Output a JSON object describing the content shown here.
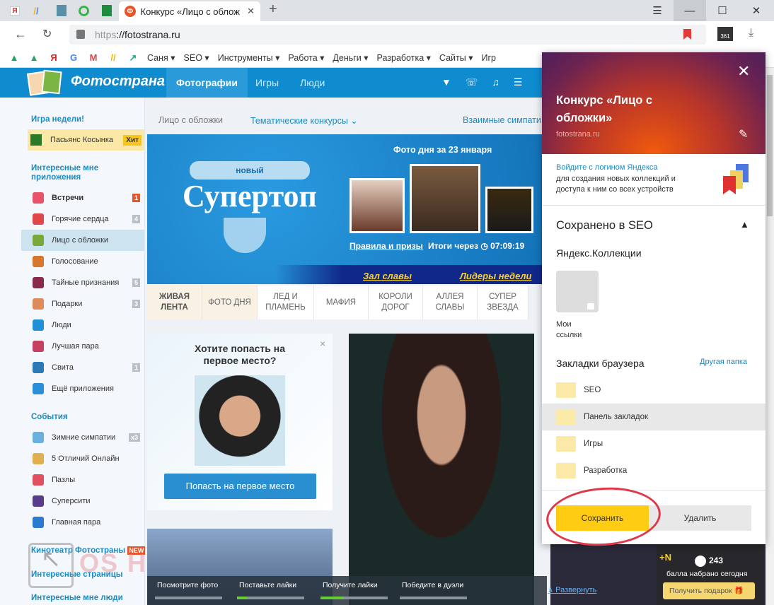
{
  "browser": {
    "pinned_tabs": [
      {
        "icon": "yandex-icon",
        "label": "Я"
      },
      {
        "icon": "google-ads-icon"
      },
      {
        "icon": "avatar-icon"
      },
      {
        "icon": "circle-icon"
      },
      {
        "icon": "sheets-icon"
      }
    ],
    "active_tab": {
      "title": "Конкурс «Лицо с облож",
      "favicon": "Ф"
    },
    "new_tab": "+",
    "url_scheme": "https",
    "url_rest": "://fotostrana.ru",
    "ext_badge": "361",
    "bookmarks": [
      "Саня",
      "SEO",
      "Инструменты",
      "Работа",
      "Деньги",
      "Разработка",
      "Сайты",
      "Игр"
    ]
  },
  "site": {
    "logo_text": "Фотострана",
    "nav": [
      "Фотографии",
      "Игры",
      "Люди"
    ],
    "sidebar": {
      "game_week_title": "Игра недели!",
      "game_week": {
        "label": "Пасьянс Косынка",
        "badge": "Хит"
      },
      "apps_title": "Интересные мне приложения",
      "apps": [
        {
          "label": "Встречи",
          "badge": "1",
          "color": "#e7536a"
        },
        {
          "label": "Горячие сердца",
          "badge": "4",
          "color": "#e04848"
        },
        {
          "label": "Лицо с обложки",
          "badge": "",
          "color": "#7aa83a"
        },
        {
          "label": "Голосование",
          "badge": "",
          "color": "#d7772d"
        },
        {
          "label": "Тайные признания",
          "badge": "5",
          "color": "#8a2a4a"
        },
        {
          "label": "Подарки",
          "badge": "3",
          "color": "#e08a5a"
        },
        {
          "label": "Люди",
          "badge": "",
          "color": "#1f8fd8"
        },
        {
          "label": "Лучшая пара",
          "badge": "",
          "color": "#c84060"
        },
        {
          "label": "Свита",
          "badge": "1",
          "color": "#2a7ab8"
        },
        {
          "label": "Ещё приложения",
          "badge": "",
          "color": "#2a8fd8"
        }
      ],
      "events_title": "События",
      "events": [
        {
          "label": "Зимние симпатии",
          "badge": "x3",
          "color": "#6ab0e0"
        },
        {
          "label": "5 Отличий Онлайн",
          "badge": "",
          "color": "#e0b050"
        },
        {
          "label": "Пазлы",
          "badge": "",
          "color": "#e05060"
        },
        {
          "label": "Суперсити",
          "badge": "",
          "color": "#5a3a8a"
        },
        {
          "label": "Главная пара",
          "badge": "",
          "color": "#2a7ad0"
        }
      ],
      "cinema": "Кинотеатр Фотостраны",
      "cinema_badge": "NEW",
      "pages": "Интересные страницы",
      "people": "Интересные мне люди"
    },
    "subnav": {
      "current": "Лицо с обложки",
      "contests": "Тематические конкурсы",
      "mutual": "Взаимные симпати"
    },
    "banner": {
      "small": "новый",
      "title": "Супертоп",
      "photo_day": "Фото дня за 23 января",
      "rules": "Правила и призы",
      "results": "Итоги через",
      "timer": "07:09:19",
      "hall": "Зал славы",
      "leaders": "Лидеры недели"
    },
    "contest_tabs": [
      "ЖИВАЯ ЛЕНТА",
      "ФОТО ДНЯ",
      "ЛЕД И ПЛАМЕНЬ",
      "МАФИЯ",
      "КОРОЛИ ДОРОГ",
      "АЛЛЕЯ СЛАВЫ",
      "СУПЕР ЗВЕЗДА"
    ],
    "promo": {
      "title": "Хотите попасть на первое место?",
      "button": "Попасть на первое место",
      "close": "×"
    },
    "tasks": [
      {
        "label": "Посмотрите фото",
        "progress": 0
      },
      {
        "label": "Поставьте лайки",
        "progress": 0.15
      },
      {
        "label": "Получите лайки",
        "progress": 0.35
      },
      {
        "label": "Победите в дуэли",
        "progress": 0
      }
    ],
    "expand": "Развернуть",
    "score": {
      "plus": "+N",
      "points": "243",
      "caption": "балла набрано сегодня",
      "gift": "Получить подарок"
    },
    "watermark": "OS Helper"
  },
  "popup": {
    "title": "Конкурс «Лицо с обложки»",
    "domain": "fotostrana.ru",
    "login_link": "Войдите с логином Яндекса",
    "login_text": "для создания новых коллекций и доступа к ним со всех устройств",
    "saved_in": "Сохранено в SEO",
    "collections_title": "Яндекс.Коллекции",
    "collection": "Мои ссылки",
    "bookmarks_title": "Закладки браузера",
    "other_folder": "Другая папка",
    "folders": [
      "SEO",
      "Панель закладок",
      "Игры",
      "Разработка"
    ],
    "selected_folder": "Панель закладок",
    "save": "Сохранить",
    "delete": "Удалить",
    "accent": "#ffcc14"
  }
}
